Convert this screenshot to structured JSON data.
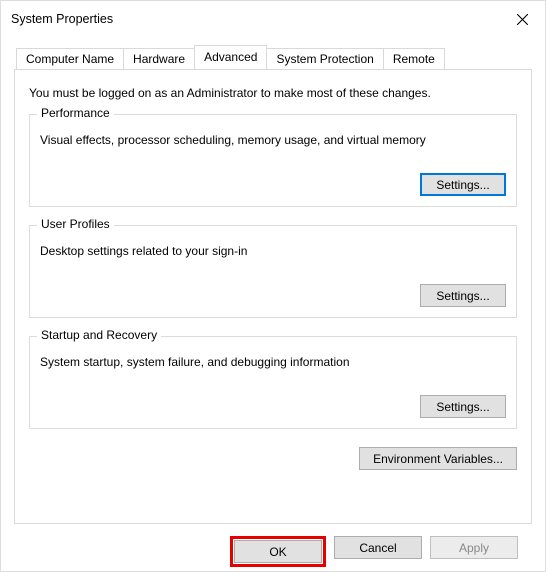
{
  "titlebar": {
    "title": "System Properties"
  },
  "tabs": {
    "computer_name": "Computer Name",
    "hardware": "Hardware",
    "advanced": "Advanced",
    "system_protection": "System Protection",
    "remote": "Remote"
  },
  "intro": "You must be logged on as an Administrator to make most of these changes.",
  "groups": {
    "performance": {
      "legend": "Performance",
      "desc": "Visual effects, processor scheduling, memory usage, and virtual memory",
      "button": "Settings..."
    },
    "user_profiles": {
      "legend": "User Profiles",
      "desc": "Desktop settings related to your sign-in",
      "button": "Settings..."
    },
    "startup_recovery": {
      "legend": "Startup and Recovery",
      "desc": "System startup, system failure, and debugging information",
      "button": "Settings..."
    }
  },
  "env_button": "Environment Variables...",
  "buttons": {
    "ok": "OK",
    "cancel": "Cancel",
    "apply": "Apply"
  }
}
